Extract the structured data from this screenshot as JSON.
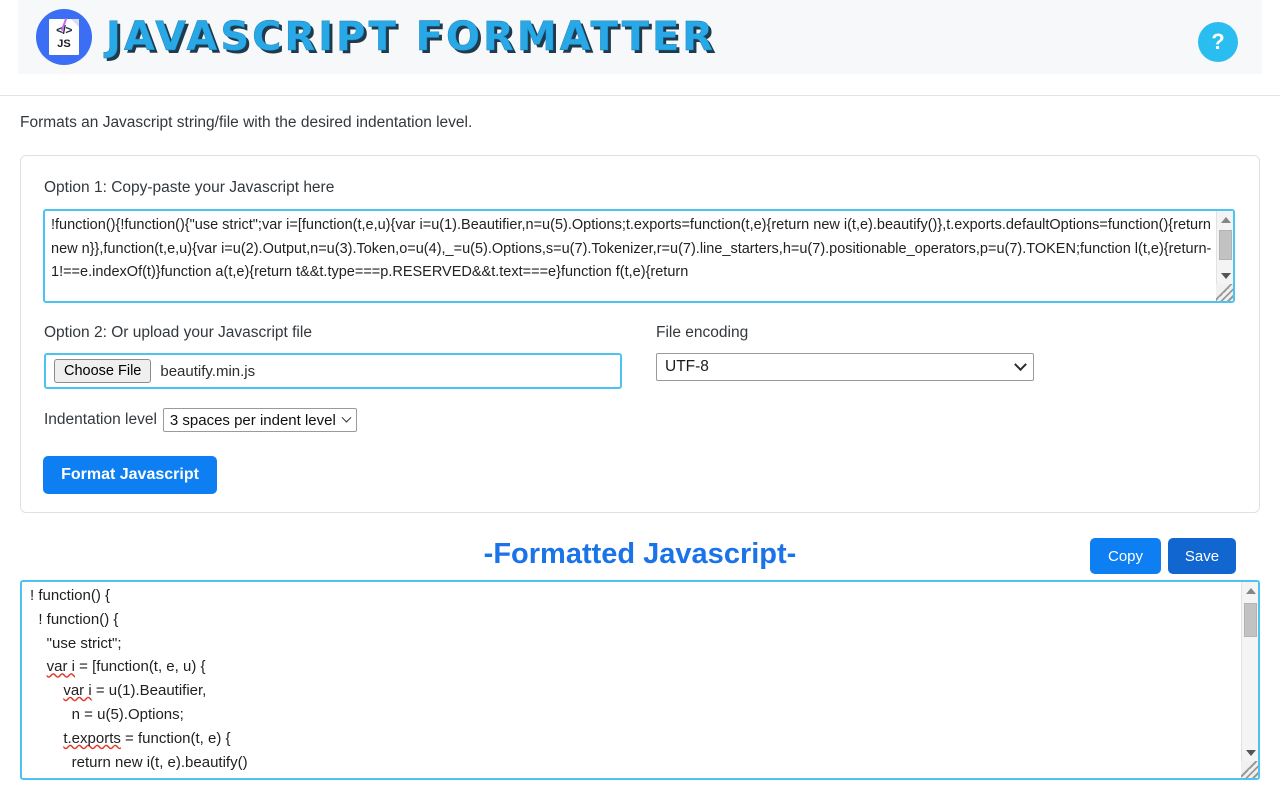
{
  "header": {
    "title": "JAVASCRIPT FORMATTER",
    "logo_icon": "js-document-icon",
    "logo_code_glyph": "</>",
    "logo_js_text": "JS",
    "help_icon": "help-question-icon",
    "help_glyph": "?",
    "accent_title_color": "#29a8e8",
    "band_color": "#f6f8fa"
  },
  "description": "Formats an Javascript string/file with the desired indentation level.",
  "form": {
    "option1_label": "Option 1: Copy-paste your Javascript here",
    "input_value": "!function(){!function(){\"use strict\";var i=[function(t,e,u){var i=u(1).Beautifier,n=u(5).Options;t.exports=function(t,e){return new i(t,e).beautify()},t.exports.defaultOptions=function(){return new n}},function(t,e,u){var i=u(2).Output,n=u(3).Token,o=u(4),_=u(5).Options,s=u(7).Tokenizer,r=u(7).line_starters,h=u(7).positionable_operators,p=u(7).TOKEN;function l(t,e){return-1!==e.indexOf(t)}function a(t,e){return t&&t.type===p.RESERVED&&t.text===e}function f(t,e){return",
    "option2_label": "Option 2: Or upload your Javascript file",
    "choose_file_label": "Choose File",
    "file_name": "beautify.min.js",
    "encoding_label": "File encoding",
    "encoding_value": "UTF-8",
    "encoding_options": [
      "UTF-8"
    ],
    "indent_label": "Indentation level",
    "indent_value": "3 spaces per indent level",
    "indent_options": [
      "3 spaces per indent level"
    ],
    "format_button": "Format Javascript"
  },
  "output": {
    "title": "-Formatted Javascript-",
    "copy_label": "Copy",
    "save_label": "Save",
    "lines": [
      "! function() {",
      "  ! function() {",
      "    \"use strict\";",
      "    var i = [function(t, e, u) {",
      "        var i = u(1).Beautifier,",
      "          n = u(5).Options;",
      "        t.exports = function(t, e) {",
      "          return new i(t, e).beautify()"
    ]
  },
  "colors": {
    "primary_button": "#0d7ff2",
    "save_button": "#1266cf",
    "field_border": "#4cc3f5",
    "output_title": "#1a73e8",
    "help_circle": "#29bdf0",
    "logo_circle": "#3b6ef4"
  }
}
